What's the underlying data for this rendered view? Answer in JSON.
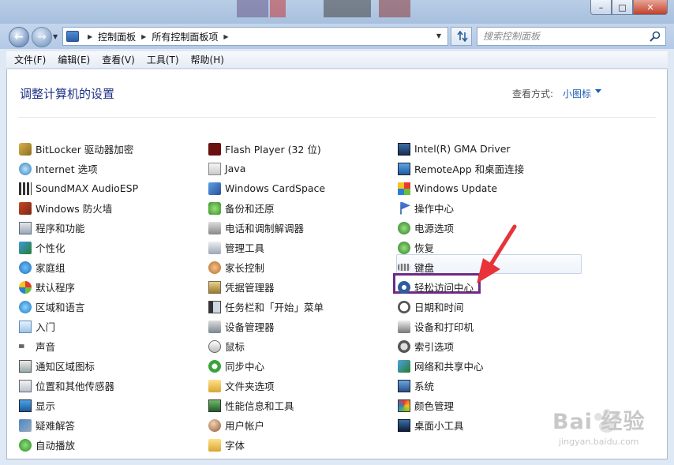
{
  "colors": {
    "title": "#1e3287",
    "link": "#1a5fb4",
    "highlight": "#6e2a87",
    "arrow": "#e8333a"
  },
  "window": {
    "minimize": "–",
    "maximize": "□",
    "close": "✕"
  },
  "nav": {
    "breadcrumbs": [
      "控制面板",
      "所有控制面板项"
    ],
    "search_placeholder": "搜索控制面板"
  },
  "menu": [
    "文件(F)",
    "编辑(E)",
    "查看(V)",
    "工具(T)",
    "帮助(H)"
  ],
  "page": {
    "title": "调整计算机的设置",
    "view_by_label": "查看方式:",
    "view_by_value": "小图标"
  },
  "columns": [
    [
      {
        "label": "BitLocker 驱动器加密",
        "icon": "bitlocker-icon"
      },
      {
        "label": "Internet 选项",
        "icon": "internet-options-icon"
      },
      {
        "label": "SoundMAX AudioESP",
        "icon": "soundmax-icon"
      },
      {
        "label": "Windows 防火墙",
        "icon": "firewall-icon"
      },
      {
        "label": "程序和功能",
        "icon": "programs-icon"
      },
      {
        "label": "个性化",
        "icon": "personalization-icon"
      },
      {
        "label": "家庭组",
        "icon": "homegroup-icon"
      },
      {
        "label": "默认程序",
        "icon": "default-programs-icon"
      },
      {
        "label": "区域和语言",
        "icon": "region-language-icon"
      },
      {
        "label": "入门",
        "icon": "getting-started-icon"
      },
      {
        "label": "声音",
        "icon": "sound-icon"
      },
      {
        "label": "通知区域图标",
        "icon": "notification-icons-icon"
      },
      {
        "label": "位置和其他传感器",
        "icon": "location-sensors-icon"
      },
      {
        "label": "显示",
        "icon": "display-icon"
      },
      {
        "label": "疑难解答",
        "icon": "troubleshooting-icon"
      },
      {
        "label": "自动播放",
        "icon": "autoplay-icon"
      }
    ],
    [
      {
        "label": "Flash Player (32 位)",
        "icon": "flash-icon"
      },
      {
        "label": "Java",
        "icon": "java-icon"
      },
      {
        "label": "Windows CardSpace",
        "icon": "cardspace-icon"
      },
      {
        "label": "备份和还原",
        "icon": "backup-icon"
      },
      {
        "label": "电话和调制解调器",
        "icon": "phone-modem-icon"
      },
      {
        "label": "管理工具",
        "icon": "admin-tools-icon"
      },
      {
        "label": "家长控制",
        "icon": "parental-controls-icon"
      },
      {
        "label": "凭据管理器",
        "icon": "credential-manager-icon"
      },
      {
        "label": "任务栏和「开始」菜单",
        "icon": "taskbar-icon"
      },
      {
        "label": "设备管理器",
        "icon": "device-manager-icon"
      },
      {
        "label": "鼠标",
        "icon": "mouse-icon"
      },
      {
        "label": "同步中心",
        "icon": "sync-center-icon"
      },
      {
        "label": "文件夹选项",
        "icon": "folder-options-icon"
      },
      {
        "label": "性能信息和工具",
        "icon": "performance-icon"
      },
      {
        "label": "用户帐户",
        "icon": "user-accounts-icon"
      },
      {
        "label": "字体",
        "icon": "fonts-icon"
      }
    ],
    [
      {
        "label": "Intel(R) GMA Driver",
        "icon": "intel-gma-icon"
      },
      {
        "label": "RemoteApp 和桌面连接",
        "icon": "remoteapp-icon"
      },
      {
        "label": "Windows Update",
        "icon": "windows-update-icon"
      },
      {
        "label": "操作中心",
        "icon": "action-center-icon"
      },
      {
        "label": "电源选项",
        "icon": "power-options-icon"
      },
      {
        "label": "恢复",
        "icon": "recovery-icon"
      },
      {
        "label": "键盘",
        "icon": "keyboard-icon"
      },
      {
        "label": "轻松访问中心",
        "icon": "ease-of-access-icon"
      },
      {
        "label": "日期和时间",
        "icon": "date-time-icon"
      },
      {
        "label": "设备和打印机",
        "icon": "devices-printers-icon"
      },
      {
        "label": "索引选项",
        "icon": "indexing-options-icon"
      },
      {
        "label": "网络和共享中心",
        "icon": "network-sharing-icon"
      },
      {
        "label": "系统",
        "icon": "system-icon"
      },
      {
        "label": "颜色管理",
        "icon": "color-management-icon"
      },
      {
        "label": "桌面小工具",
        "icon": "gadgets-icon"
      }
    ]
  ],
  "watermark": {
    "brand": "Bai  经验",
    "url": "jingyan.baidu.com"
  }
}
